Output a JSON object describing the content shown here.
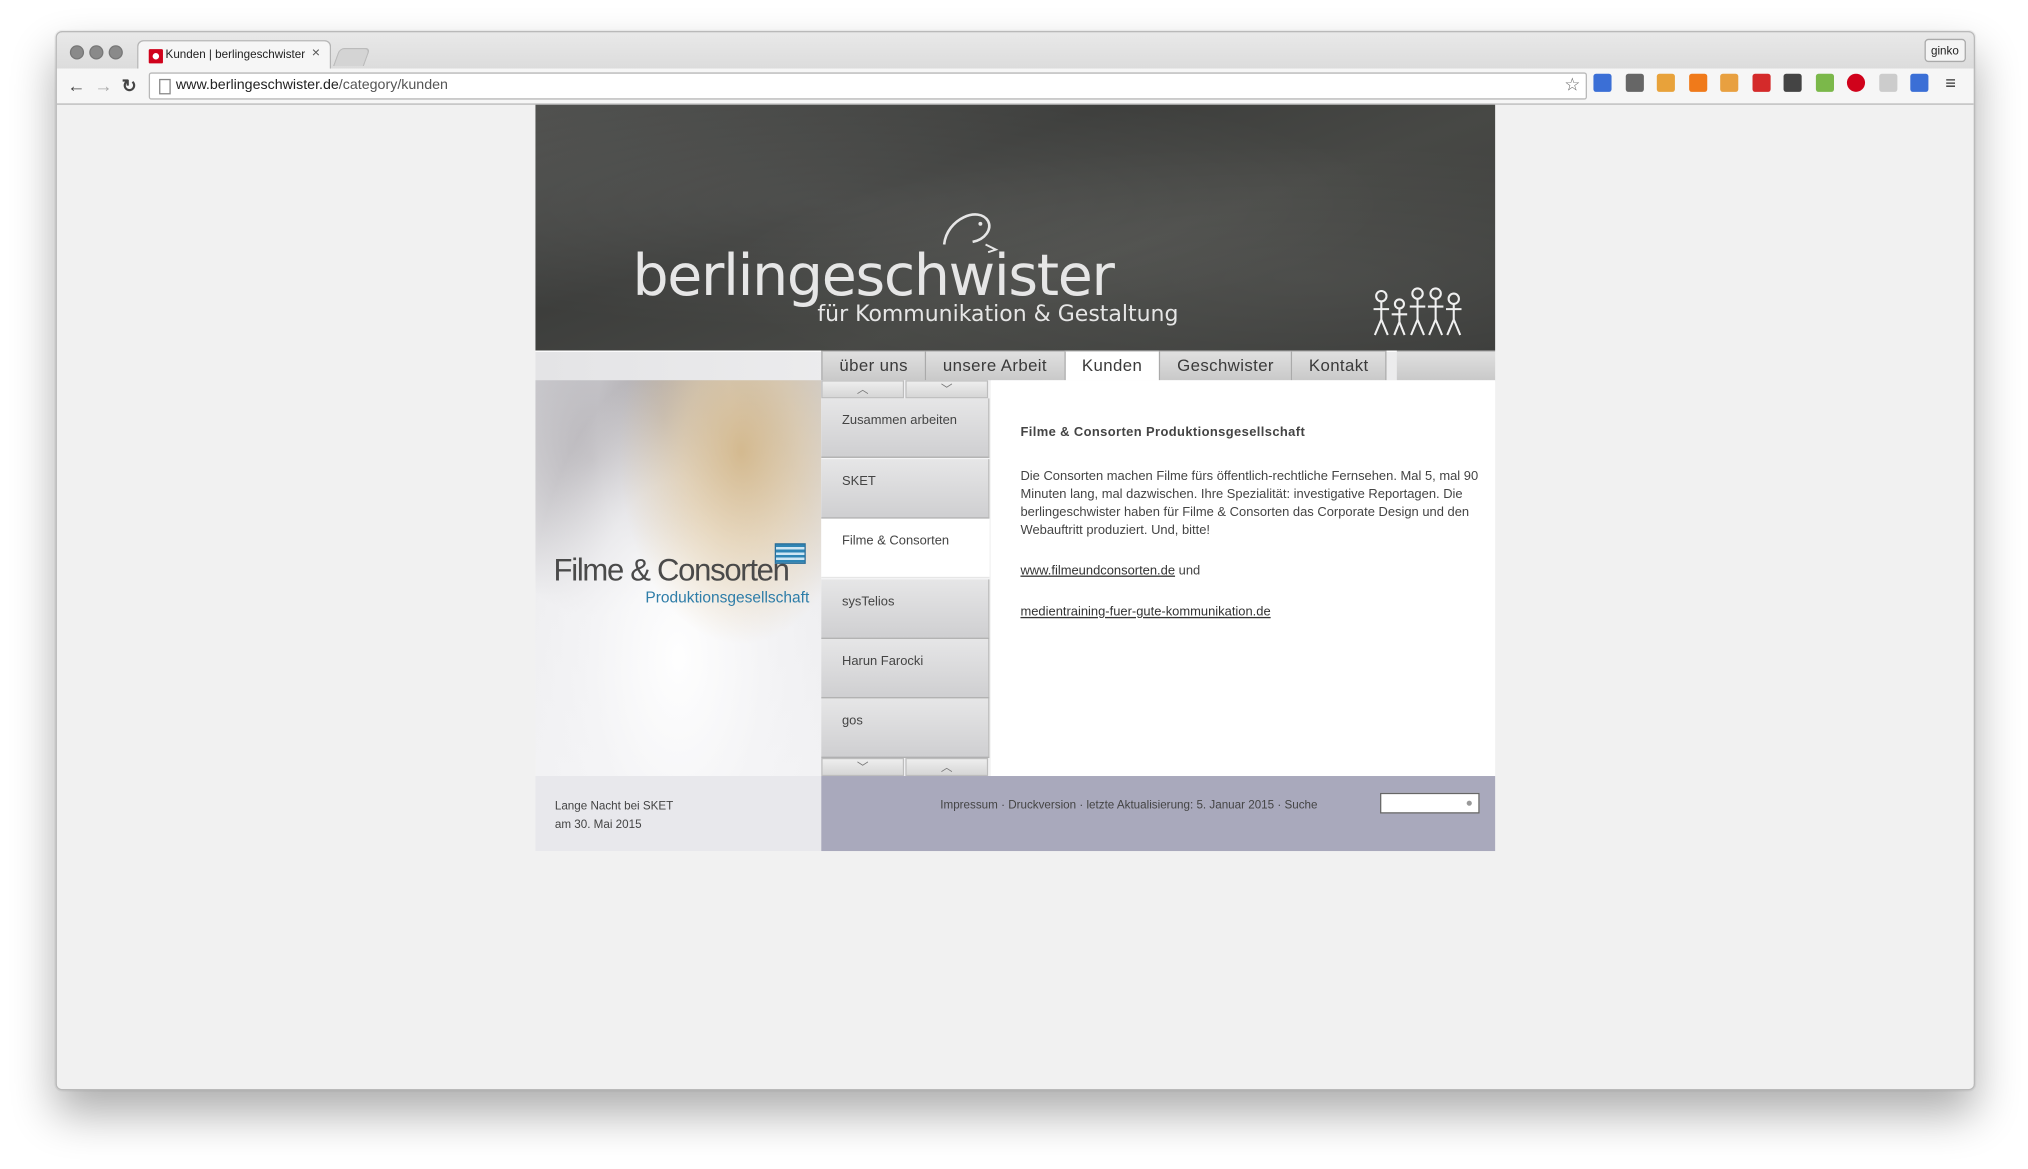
{
  "browser": {
    "tab_title": "Kunden | berlingeschwister",
    "tab_close": "×",
    "profile_name": "ginko",
    "url_host": "www.berlingeschwister.de",
    "url_path": "/category/kunden",
    "nav": {
      "back": "←",
      "forward": "→",
      "reload": "↻"
    },
    "star_icon": "☆",
    "menu_icon": "≡",
    "extensions": [
      "delicious-icon",
      "eyedropper-icon",
      "rss-icon",
      "chart-icon",
      "timer-icon",
      "feed-icon",
      "bookmark-star-icon",
      "palette-icon",
      "adblock-icon",
      "translate-icon",
      "delicious2-icon"
    ],
    "extension_colors": [
      "#3b6fd6",
      "#666666",
      "#e8a23a",
      "#f07a1a",
      "#e8a040",
      "#d42a2a",
      "#444444",
      "#7bb84a",
      "#d0021b",
      "#cccccc",
      "#3b6fd6"
    ]
  },
  "site": {
    "logo_main": "berlingeschwister",
    "logo_sub": "für Kommunikation & Gestaltung",
    "main_nav": [
      "über uns",
      "unsere Arbeit",
      "Kunden",
      "Geschwister",
      "Kontakt"
    ],
    "active_nav": "Kunden",
    "feature": {
      "logo_main": "Filme & Consorten",
      "logo_sub": "Produktionsgesellschaft"
    },
    "sub_nav": [
      "Zusammen arbeiten",
      "SKET",
      "Filme & Consorten",
      "sysTelios",
      "Harun Farocki",
      "gos"
    ],
    "active_sub": "Filme & Consorten",
    "content": {
      "title": "Filme & Consorten Produktionsgesellschaft",
      "body": "Die Consorten machen Filme fürs öffentlich-rechtliche Fernsehen. Mal 5, mal 90 Minuten lang, mal dazwischen. Ihre Spezialität: investigative Reportagen. Die berlingeschwister haben für Filme & Consorten das Corporate Design und den Webauftritt produziert. Und, bitte!",
      "link1": "www.filmeundconsorten.de",
      "link1_suffix": " und",
      "link2": "medientraining-fuer-gute-kommunikation.de"
    },
    "footer": {
      "news_line1": "Lange Nacht bei SKET",
      "news_line2": "am 30. Mai 2015",
      "links": "Impressum · Druckversion · letzte Aktualisierung: 5. Januar 2015 · Suche",
      "search_placeholder": ""
    }
  }
}
